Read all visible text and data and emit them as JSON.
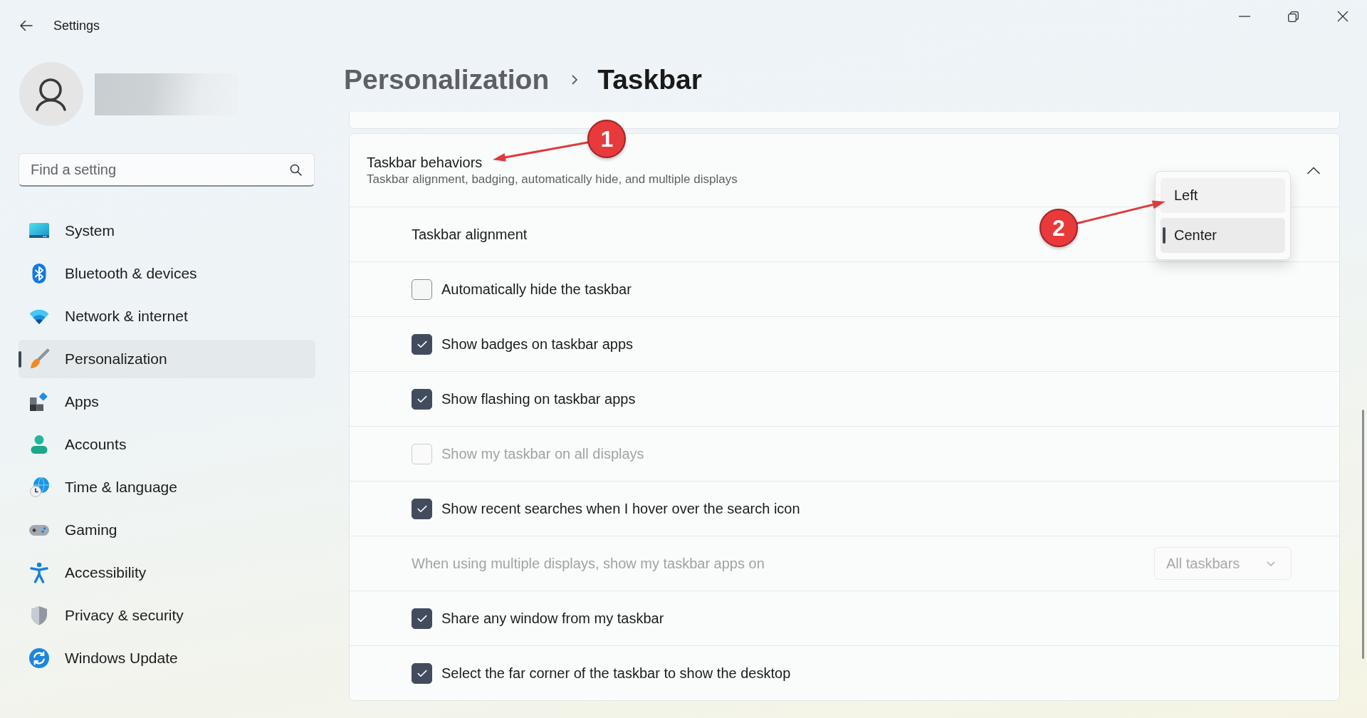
{
  "window": {
    "title": "Settings"
  },
  "search": {
    "placeholder": "Find a setting"
  },
  "sidebar": {
    "items": [
      {
        "label": "System",
        "selected": false
      },
      {
        "label": "Bluetooth & devices",
        "selected": false
      },
      {
        "label": "Network & internet",
        "selected": false
      },
      {
        "label": "Personalization",
        "selected": true
      },
      {
        "label": "Apps",
        "selected": false
      },
      {
        "label": "Accounts",
        "selected": false
      },
      {
        "label": "Time & language",
        "selected": false
      },
      {
        "label": "Gaming",
        "selected": false
      },
      {
        "label": "Accessibility",
        "selected": false
      },
      {
        "label": "Privacy & security",
        "selected": false
      },
      {
        "label": "Windows Update",
        "selected": false
      }
    ]
  },
  "breadcrumb": [
    {
      "label": "Personalization"
    },
    {
      "label": "Taskbar"
    }
  ],
  "expander": {
    "title": "Taskbar behaviors",
    "subtitle": "Taskbar alignment, badging, automatically hide, and multiple displays",
    "expanded": true,
    "annotation": "1",
    "rows": [
      {
        "kind": "select",
        "label": "Taskbar alignment",
        "disabled": false,
        "expanded": true,
        "options": [
          {
            "label": "Left",
            "selected": false,
            "annotation": "2"
          },
          {
            "label": "Center",
            "selected": true
          }
        ]
      },
      {
        "kind": "checkbox",
        "label": "Automatically hide the taskbar",
        "checked": false,
        "disabled": false
      },
      {
        "kind": "checkbox",
        "label": "Show badges on taskbar apps",
        "checked": true,
        "disabled": false
      },
      {
        "kind": "checkbox",
        "label": "Show flashing on taskbar apps",
        "checked": true,
        "disabled": false
      },
      {
        "kind": "checkbox",
        "label": "Show my taskbar on all displays",
        "checked": false,
        "disabled": true
      },
      {
        "kind": "checkbox",
        "label": "Show recent searches when I hover over the search icon",
        "checked": true,
        "disabled": false
      },
      {
        "kind": "select",
        "label": "When using multiple displays, show my taskbar apps on",
        "disabled": true,
        "expanded": false,
        "value": "All taskbars"
      },
      {
        "kind": "checkbox",
        "label": "Share any window from my taskbar",
        "checked": true,
        "disabled": false
      },
      {
        "kind": "checkbox",
        "label": "Select the far corner of the taskbar to show the desktop",
        "checked": true,
        "disabled": false
      }
    ]
  }
}
